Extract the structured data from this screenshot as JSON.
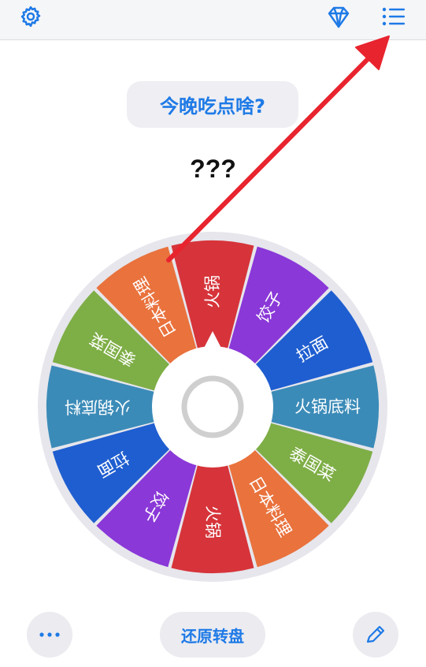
{
  "header": {
    "settings_icon": "gear-icon",
    "premium_icon": "diamond-icon",
    "list_icon": "list-icon"
  },
  "title": "今晚吃点啥?",
  "result": "???",
  "wheel": {
    "segments": [
      {
        "label": "火锅",
        "color": "#d6343a"
      },
      {
        "label": "饺子",
        "color": "#8a38d8"
      },
      {
        "label": "拉面",
        "color": "#1f5ed0"
      },
      {
        "label": "火锅底料",
        "color": "#3b8bb8"
      },
      {
        "label": "泰国菜",
        "color": "#7eae46"
      },
      {
        "label": "日本料理",
        "color": "#e9723d"
      },
      {
        "label": "火锅",
        "color": "#d6343a"
      },
      {
        "label": "饺子",
        "color": "#8a38d8"
      },
      {
        "label": "拉面",
        "color": "#1f5ed0"
      },
      {
        "label": "火锅底料",
        "color": "#3b8bb8"
      },
      {
        "label": "泰国菜",
        "color": "#7eae46"
      },
      {
        "label": "日本料理",
        "color": "#e9723d"
      }
    ]
  },
  "bottom": {
    "more_icon": "more-dots-icon",
    "reset_label": "还原转盘",
    "edit_icon": "edit-icon"
  },
  "colors": {
    "accent": "#1e7ae6",
    "annotation_arrow": "#e8242e"
  }
}
